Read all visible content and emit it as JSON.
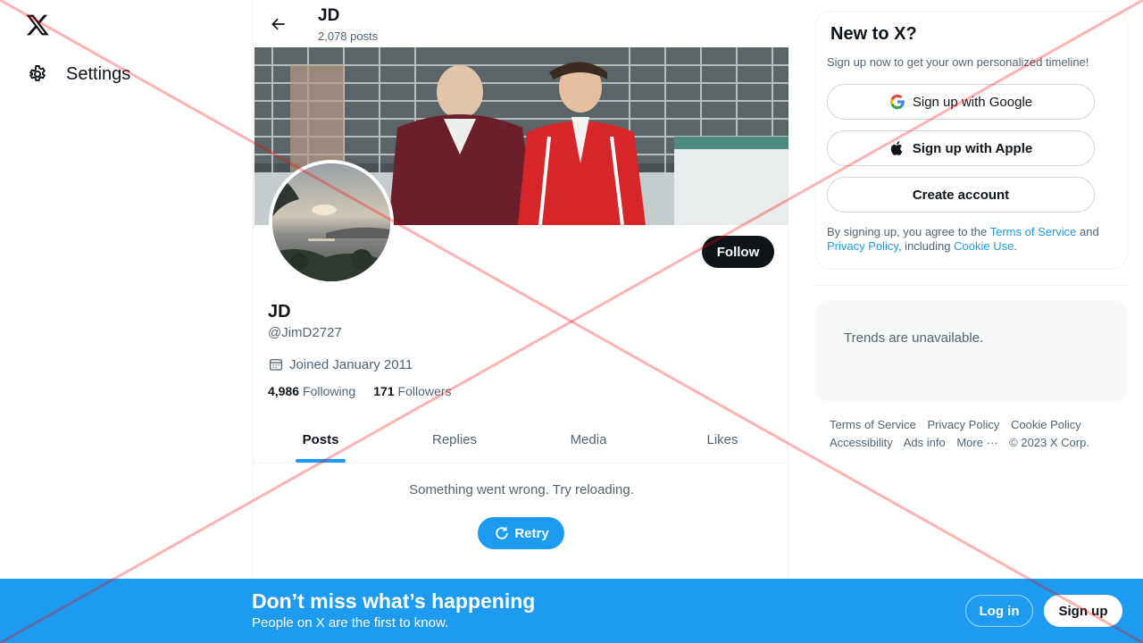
{
  "nav": {
    "settings_label": "Settings"
  },
  "header": {
    "title": "JD",
    "post_count": "2,078 posts"
  },
  "profile": {
    "name": "JD",
    "handle": "@JimD2727",
    "joined": "Joined January 2011",
    "following_count": "4,986",
    "following_label": "Following",
    "followers_count": "171",
    "followers_label": "Followers",
    "follow_label": "Follow"
  },
  "tabs": [
    {
      "label": "Posts",
      "active": true
    },
    {
      "label": "Replies",
      "active": false
    },
    {
      "label": "Media",
      "active": false
    },
    {
      "label": "Likes",
      "active": false
    }
  ],
  "feed": {
    "error_text": "Something went wrong. Try reloading.",
    "retry_label": "Retry"
  },
  "signup": {
    "title": "New to X?",
    "subtitle": "Sign up now to get your own personalized timeline!",
    "google_label": "Sign up with Google",
    "apple_label": "Sign up with Apple",
    "create_label": "Create account",
    "terms_prefix": "By signing up, you agree to the ",
    "terms_link": "Terms of Service",
    "terms_and": " and ",
    "privacy_link": "Privacy Policy",
    "terms_including": ", including ",
    "cookie_link": "Cookie Use",
    "terms_end": "."
  },
  "trends": {
    "text": "Trends are unavailable."
  },
  "footer": {
    "terms": "Terms of Service",
    "privacy": "Privacy Policy",
    "cookie": "Cookie Policy",
    "accessibility": "Accessibility",
    "ads": "Ads info",
    "more": "More ···",
    "copyright": "© 2023 X Corp."
  },
  "bottom_bar": {
    "title": "Don’t miss what’s happening",
    "subtitle": "People on X are the first to know.",
    "login_label": "Log in",
    "signup_label": "Sign up"
  },
  "colors": {
    "accent": "#1d9bf0",
    "text_primary": "#0f1419",
    "text_secondary": "#536471"
  }
}
